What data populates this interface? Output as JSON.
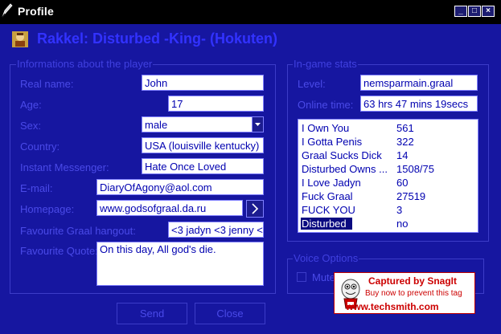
{
  "window": {
    "title": "Profile",
    "controls": {
      "minimize": "_",
      "maximize": "□",
      "close": "×"
    }
  },
  "header": {
    "player_name": "Rakkel: Disturbed -King- (Hokuten)"
  },
  "player_info": {
    "title": "Informations about the player",
    "fields": {
      "real_name": {
        "label": "Real name:",
        "value": "John"
      },
      "age": {
        "label": "Age:",
        "value": "17"
      },
      "sex": {
        "label": "Sex:",
        "value": "male"
      },
      "country": {
        "label": "Country:",
        "value": "USA (louisville kentucky)"
      },
      "messenger": {
        "label": "Instant Messenger:",
        "value": "Hate Once Loved"
      },
      "email": {
        "label": "E-mail:",
        "value": "DiaryOfAgony@aol.com"
      },
      "homepage": {
        "label": "Homepage:",
        "value": "www.godsofgraal.da.ru"
      },
      "hangout": {
        "label": "Favourite Graal hangout:",
        "value": "<3 jadyn <3 jenny <"
      },
      "quote": {
        "label": "Favourite Quote:",
        "value": "On this day, All god's die."
      }
    }
  },
  "ingame_stats": {
    "title": "In-game stats",
    "level": {
      "label": "Level:",
      "value": "nemsparmain.graal"
    },
    "online_time": {
      "label": "Online time:",
      "value": "63 hrs 47 mins 19secs"
    },
    "list": [
      {
        "name": "I Own You",
        "value": "561"
      },
      {
        "name": "I Gotta Penis",
        "value": "322"
      },
      {
        "name": "Graal Sucks Dick",
        "value": "14"
      },
      {
        "name": "Disturbed Owns ...",
        "value": "1508/75"
      },
      {
        "name": "I Love Jadyn",
        "value": "60"
      },
      {
        "name": "Fuck Graal",
        "value": "27519"
      },
      {
        "name": "FUCK YOU",
        "value": "3"
      },
      {
        "name": "Disturbed",
        "value": "no"
      }
    ]
  },
  "voice_options": {
    "title": "Voice Options",
    "mute_label": "Mute"
  },
  "buttons": {
    "send": "Send",
    "close": "Close"
  },
  "watermark": {
    "line1": "Captured by SnagIt",
    "line2": "Buy now to prevent this tag",
    "line3": "www.techsmith.com"
  },
  "colors": {
    "background": "#1616a0",
    "label": "#4a4ae8",
    "field_text": "#0000b0",
    "title_bar": "#000000",
    "watermark": "#cc0000"
  }
}
